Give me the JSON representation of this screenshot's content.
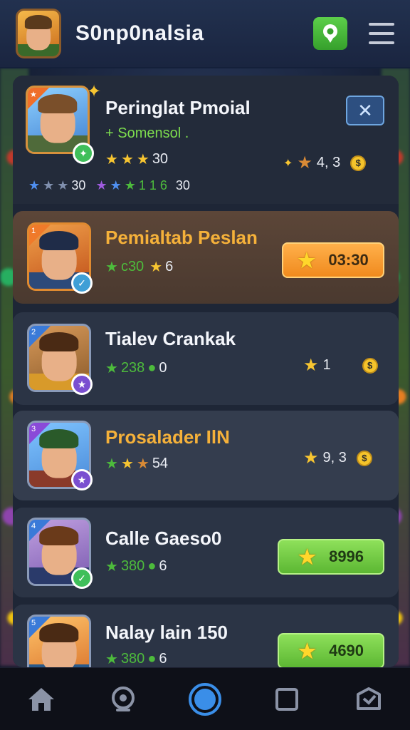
{
  "header": {
    "title": "S0np0nalsia",
    "location_icon": "location-pin-icon",
    "menu_icon": "menu-icon"
  },
  "featured": {
    "name": "Peringlat Pmoial",
    "subtitle": "+ Somensol .",
    "stars_value": "30",
    "rating": "4, 3",
    "ranks_value": "30",
    "ranks_text": "1 1 6",
    "close_label": "✕"
  },
  "players": [
    {
      "name": "Pemialtab Peslan",
      "stat": "c30",
      "stat2": "6",
      "cta": "03:30"
    },
    {
      "name": "Tialev Crankak",
      "stat": "238",
      "stat2": "0",
      "right": "1"
    },
    {
      "name": "Prosalader IlN",
      "stat": "54",
      "right": "9, 3"
    },
    {
      "name": "Calle Gaeso0",
      "stat": "380",
      "stat2": "6",
      "cta": "8996"
    },
    {
      "name": "Nalay lain 150",
      "stat": "380",
      "stat2": "6",
      "cta": "4690"
    }
  ],
  "nav": [
    "home-icon",
    "webcam-icon",
    "record-icon",
    "square-icon",
    "box-icon"
  ],
  "colors": {
    "accent_green": "#5cb733",
    "accent_orange": "#f08a1e",
    "panel": "#1e2636",
    "gold_name": "#f5b13a"
  }
}
